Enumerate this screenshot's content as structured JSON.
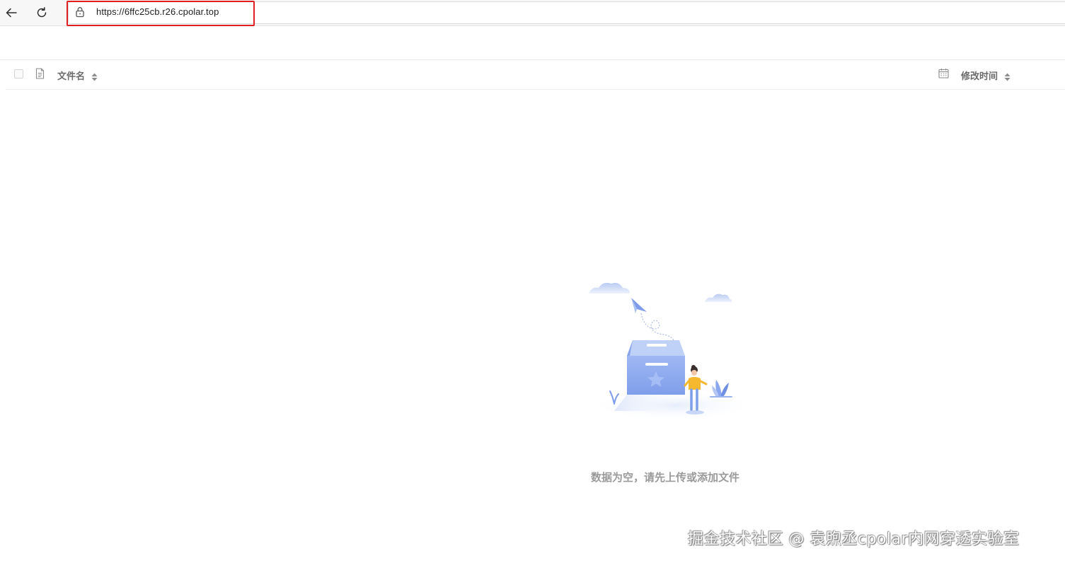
{
  "browser": {
    "url": "https://6ffc25cb.r26.cpolar.top",
    "back_icon": "arrow-left-icon",
    "reload_icon": "reload-icon",
    "lock_icon": "lock-icon",
    "highlight_color": "#e02020"
  },
  "table": {
    "columns": [
      {
        "label": "文件名",
        "icon": "file-icon",
        "sortable": true
      },
      {
        "label": "修改时间",
        "icon": "calendar-icon",
        "sortable": true
      }
    ]
  },
  "empty_state": {
    "message": "数据为空，请先上传或添加文件",
    "illustration": "empty-box-illustration"
  },
  "watermark": {
    "text": "掘金技术社区 @ 袁煦丞cpolar内网穿透实验室"
  }
}
